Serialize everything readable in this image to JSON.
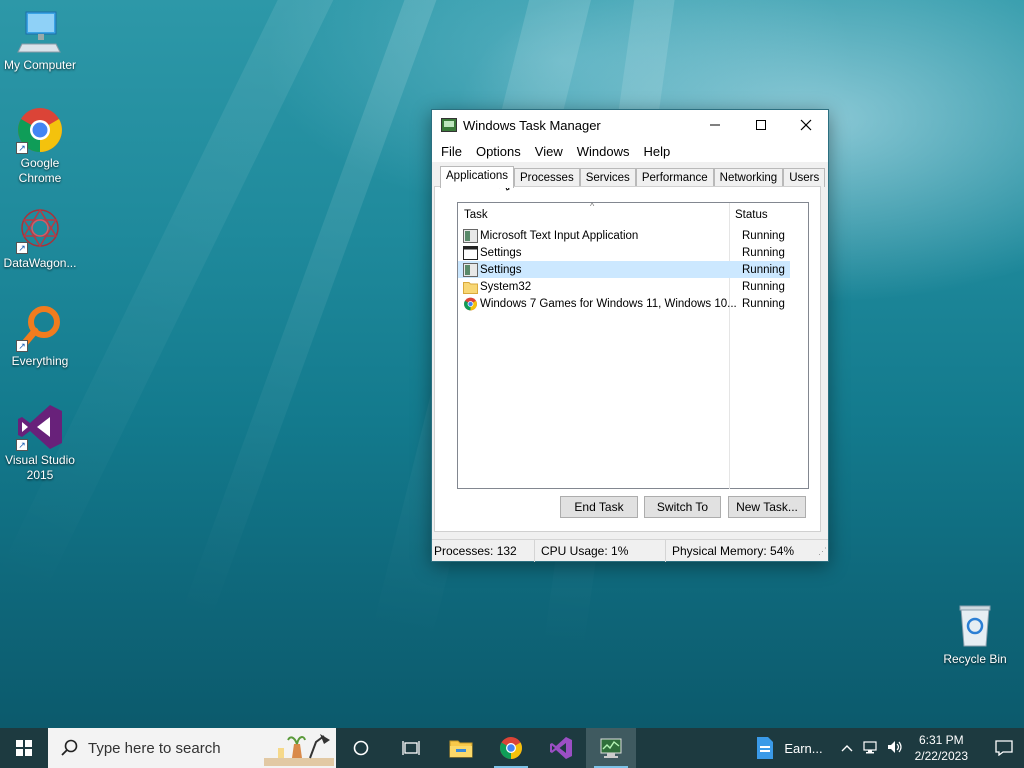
{
  "desktop": {
    "icons": [
      {
        "label": "My Computer"
      },
      {
        "label": "Google Chrome"
      },
      {
        "label": "DataWagon..."
      },
      {
        "label": "Everything"
      },
      {
        "label": "Visual Studio 2015"
      },
      {
        "label": "Recycle Bin"
      }
    ]
  },
  "window": {
    "title": "Windows Task Manager",
    "menu": [
      "File",
      "Options",
      "View",
      "Windows",
      "Help"
    ],
    "tabs": [
      "Applications",
      "Processes",
      "Services",
      "Performance",
      "Networking",
      "Users"
    ],
    "active_tab": "Applications",
    "columns": {
      "task": "Task",
      "status": "Status"
    },
    "rows": [
      {
        "task": "Microsoft Text Input Application",
        "status": "Running",
        "icon": "app-window-icon"
      },
      {
        "task": "Settings",
        "status": "Running",
        "icon": "window-icon"
      },
      {
        "task": "Settings",
        "status": "Running",
        "icon": "app-window-icon",
        "selected": true
      },
      {
        "task": "System32",
        "status": "Running",
        "icon": "folder-icon"
      },
      {
        "task": "Windows 7 Games for Windows 11, Windows 10...",
        "status": "Running",
        "icon": "chrome-icon"
      }
    ],
    "buttons": {
      "end_task": "End Task",
      "switch_to": "Switch To",
      "new_task": "New Task..."
    },
    "statusbar": {
      "processes": "Processes: 132",
      "cpu": "CPU Usage: 1%",
      "memory": "Physical Memory: 54%"
    }
  },
  "taskbar": {
    "search_placeholder": "Type here to search",
    "weather": "Earn...",
    "time": "6:31 PM",
    "date": "2/22/2023"
  },
  "colors": {
    "selection": "#cce8ff",
    "taskbar": "#1d3a40",
    "accent": "#7dc3e8"
  }
}
